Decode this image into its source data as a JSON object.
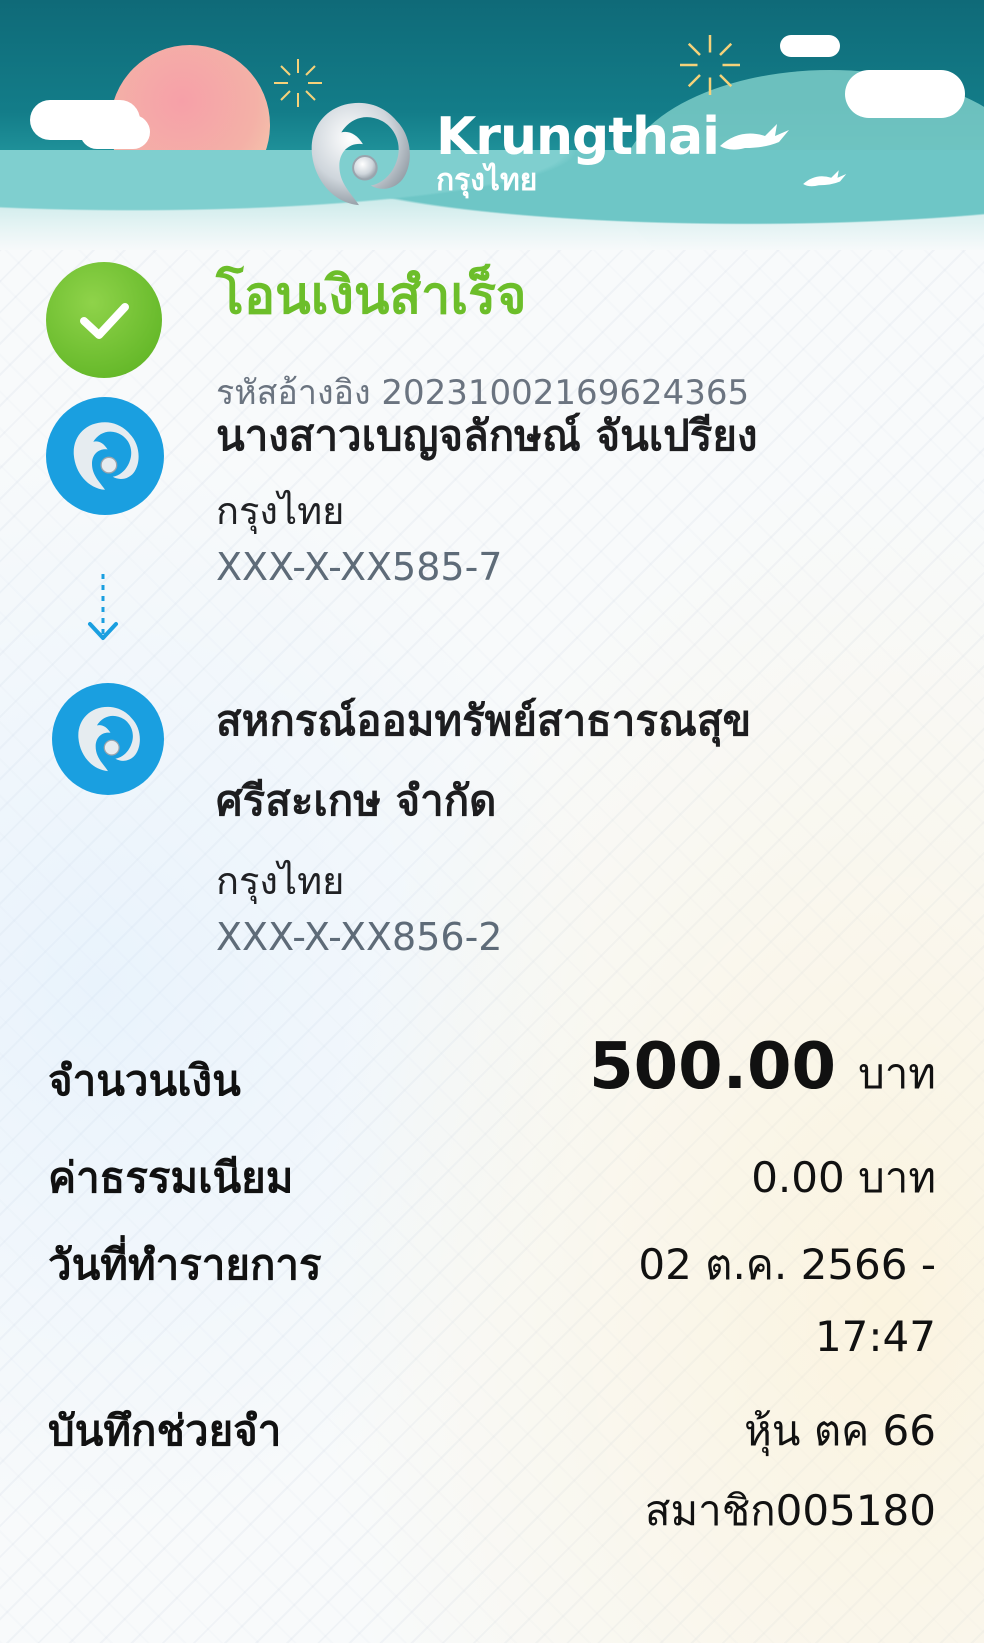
{
  "brand": {
    "name_en": "Krungthai",
    "name_th": "กรุงไทย",
    "color_primary": "#1a9fe0",
    "color_header": "#137d89",
    "color_success": "#6cbe2a"
  },
  "status": {
    "icon": "check-circle-icon",
    "title": "โอนเงินสำเร็จ",
    "reference_label": "รหัสอ้างอิง",
    "reference_value": "2023100216962436​5"
  },
  "from": {
    "name": "นางสาวเบญจลักษณ์ จันเปรียง",
    "bank": "กรุงไทย",
    "account": "XXX-X-XX585-7"
  },
  "to": {
    "name_line1": "สหกรณ์ออมทรัพย์สาธารณสุข",
    "name_line2": "ศรีสะเกษ จำกัด",
    "bank": "กรุงไทย",
    "account": "XXX-X-XX856-2"
  },
  "details": {
    "amount_label": "จำนวนเงิน",
    "amount_value": "500.00",
    "amount_unit": "บาท",
    "fee_label": "ค่าธรรมเนียม",
    "fee_value": "0.00 บาท",
    "date_label": "วันที่ทำรายการ",
    "date_value_line1": "02 ต.ค. 2566 -",
    "date_value_line2": "17:47",
    "memo_label": "บันทึกช่วยจำ",
    "memo_value_line1": "หุ้น ตค 66",
    "memo_value_line2": "สมาชิก005180"
  }
}
